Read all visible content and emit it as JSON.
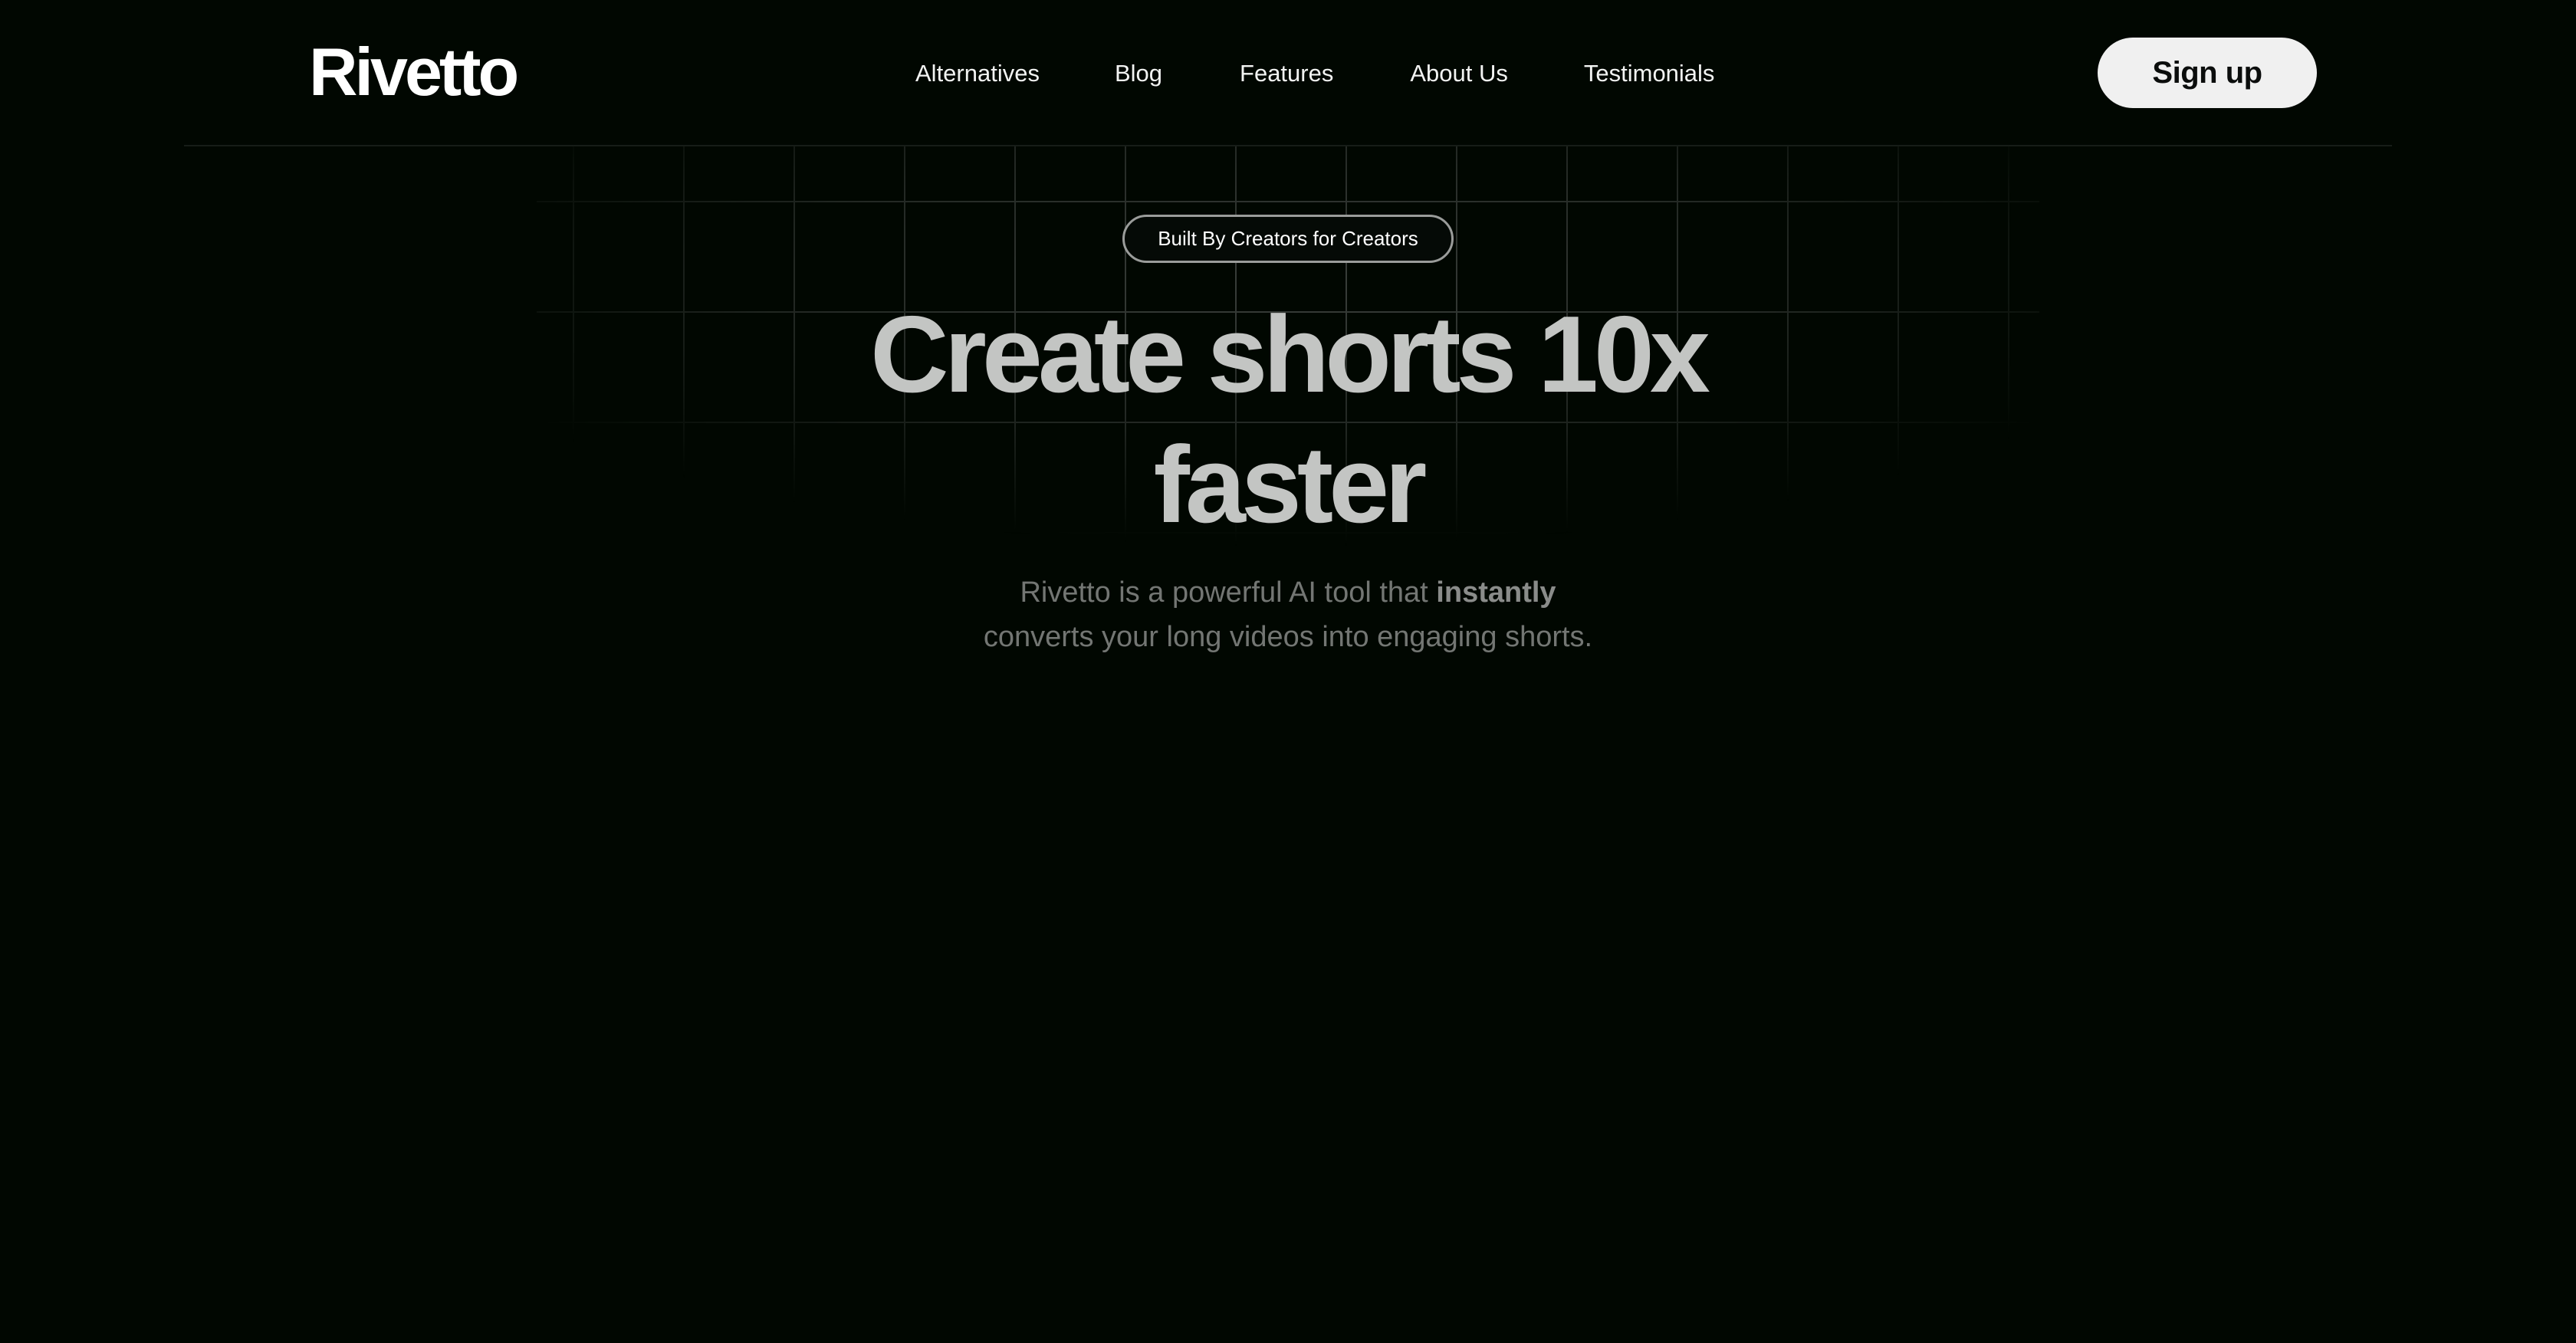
{
  "header": {
    "logo": "Rivetto",
    "nav": [
      {
        "label": "Alternatives"
      },
      {
        "label": "Blog"
      },
      {
        "label": "Features"
      },
      {
        "label": "About Us"
      },
      {
        "label": "Testimonials"
      }
    ],
    "signup_label": "Sign up"
  },
  "hero": {
    "badge": "Built By Creators for Creators",
    "headline_line1": "Create shorts 10x",
    "headline_line2": "faster",
    "subtext_pre": "Rivetto is a powerful AI tool that ",
    "subtext_bold": "instantly",
    "subtext_post": "converts your long videos into engaging shorts."
  },
  "colors": {
    "background": "#010701",
    "nav_text": "#f2f3f2",
    "button_bg": "#f0f0f0",
    "headline": "#c3c5c3",
    "subtext": "#737673"
  }
}
